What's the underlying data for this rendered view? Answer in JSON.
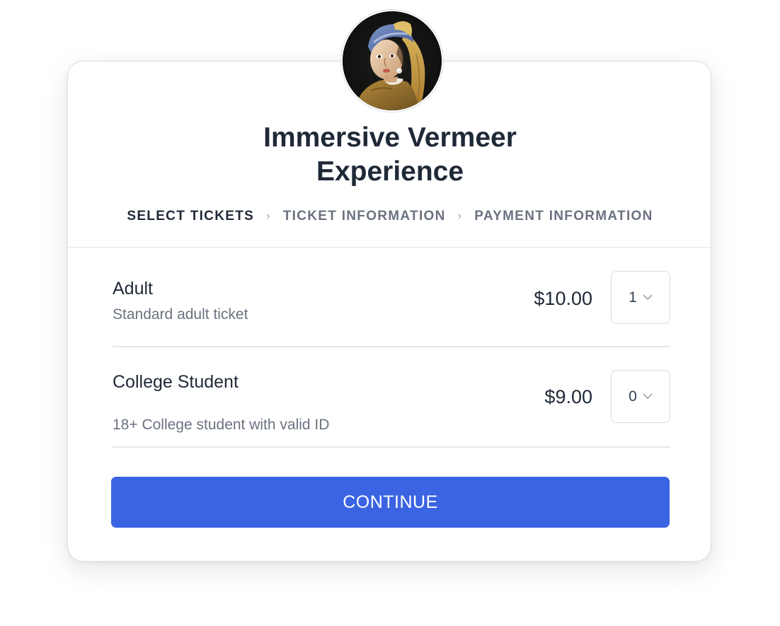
{
  "event": {
    "title": "Immersive Vermeer Experience",
    "avatar_icon": "girl-with-pearl-earring-portrait"
  },
  "steps": [
    {
      "label": "SELECT TICKETS",
      "active": true
    },
    {
      "label": "TICKET INFORMATION",
      "active": false
    },
    {
      "label": "PAYMENT INFORMATION",
      "active": false
    }
  ],
  "step_separator_icon": "chevron-right-icon",
  "tickets": [
    {
      "name": "Adult",
      "description": "Standard adult ticket",
      "price": "$10.00",
      "quantity": "1"
    },
    {
      "name": "College Student",
      "description": "18+ College student with valid ID",
      "price": "$9.00",
      "quantity": "0"
    }
  ],
  "quantity_icon": "chevron-down-icon",
  "actions": {
    "continue_label": "CONTINUE"
  },
  "colors": {
    "accent": "#3b64e2",
    "text_primary": "#1f2937",
    "text_secondary": "#6b7280"
  }
}
